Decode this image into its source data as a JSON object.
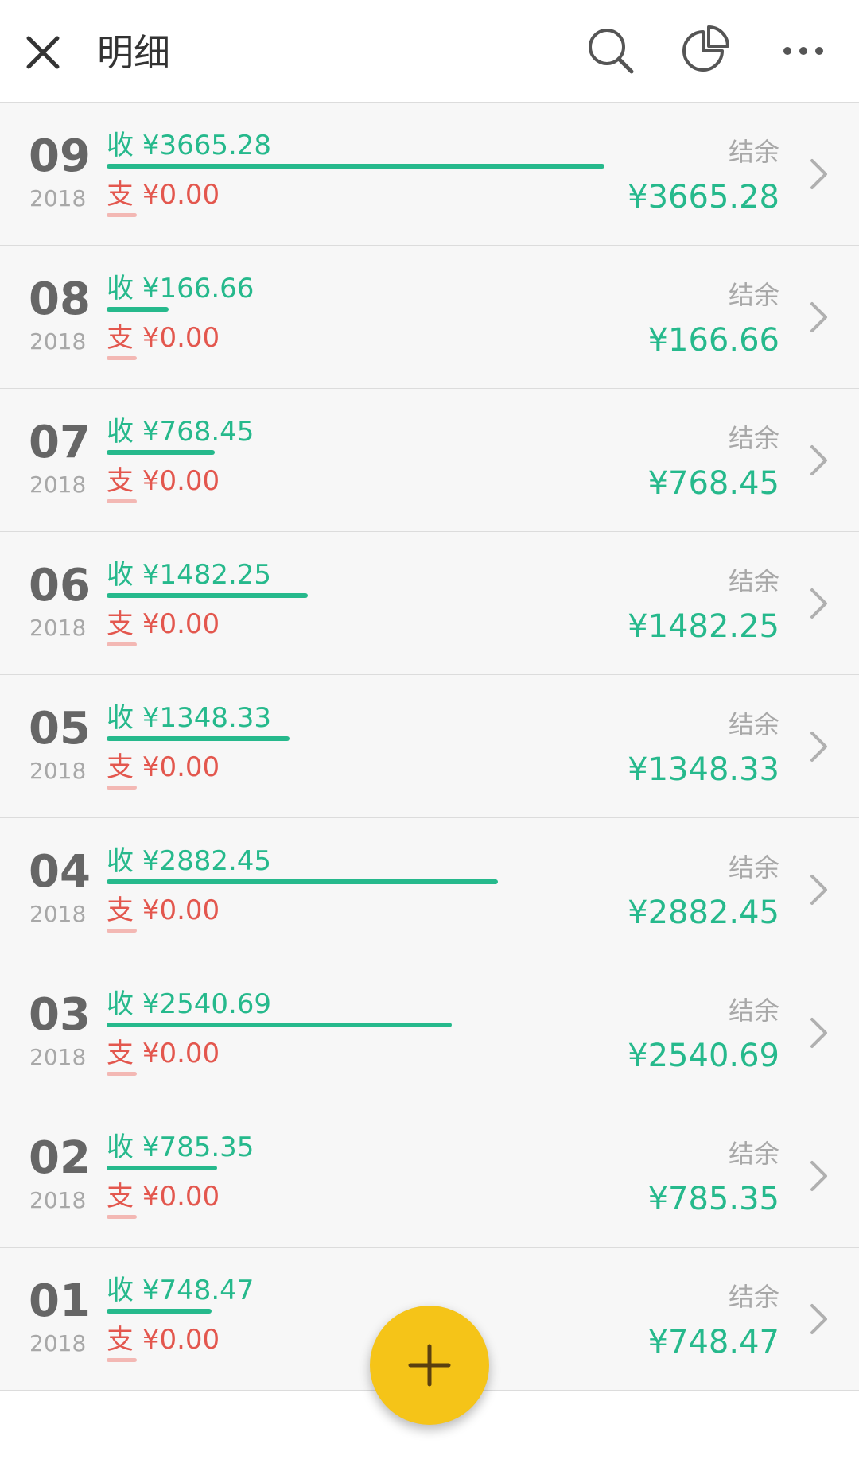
{
  "header": {
    "title": "明细",
    "icons": [
      "close-icon",
      "search-icon",
      "pie-chart-icon",
      "more-icon"
    ]
  },
  "colors": {
    "income": "#26b98c",
    "expense": "#e3574e",
    "fab": "#f5c418"
  },
  "labels": {
    "income_prefix": "收",
    "expense_prefix": "支",
    "balance_label": "结余"
  },
  "rows": [
    {
      "month": "09",
      "year": "2018",
      "income": "¥3665.28",
      "expense": "¥0.00",
      "balance": "¥3665.28",
      "income_ratio": 1.0
    },
    {
      "month": "08",
      "year": "2018",
      "income": "¥166.66",
      "expense": "¥0.00",
      "balance": "¥166.66",
      "income_ratio": 0.125
    },
    {
      "month": "07",
      "year": "2018",
      "income": "¥768.45",
      "expense": "¥0.00",
      "balance": "¥768.45",
      "income_ratio": 0.218
    },
    {
      "month": "06",
      "year": "2018",
      "income": "¥1482.25",
      "expense": "¥0.00",
      "balance": "¥1482.25",
      "income_ratio": 0.404
    },
    {
      "month": "05",
      "year": "2018",
      "income": "¥1348.33",
      "expense": "¥0.00",
      "balance": "¥1348.33",
      "income_ratio": 0.368
    },
    {
      "month": "04",
      "year": "2018",
      "income": "¥2882.45",
      "expense": "¥0.00",
      "balance": "¥2882.45",
      "income_ratio": 0.786
    },
    {
      "month": "03",
      "year": "2018",
      "income": "¥2540.69",
      "expense": "¥0.00",
      "balance": "¥2540.69",
      "income_ratio": 0.693
    },
    {
      "month": "02",
      "year": "2018",
      "income": "¥785.35",
      "expense": "¥0.00",
      "balance": "¥785.35",
      "income_ratio": 0.222
    },
    {
      "month": "01",
      "year": "2018",
      "income": "¥748.47",
      "expense": "¥0.00",
      "balance": "¥748.47",
      "income_ratio": 0.211
    }
  ],
  "fab": {
    "icon": "plus-icon"
  }
}
